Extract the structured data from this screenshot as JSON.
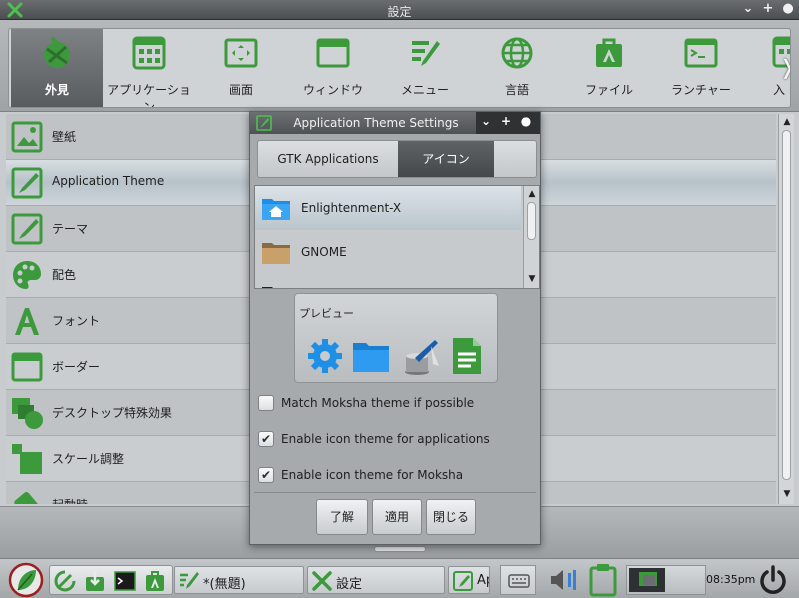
{
  "window": {
    "title": "設定"
  },
  "toolbar": {
    "items": [
      {
        "label": "外見",
        "icon": "appearance-icon",
        "selected": true
      },
      {
        "label": "アプリケーション",
        "icon": "applications-icon"
      },
      {
        "label": "画面",
        "icon": "screen-icon"
      },
      {
        "label": "ウィンドウ",
        "icon": "window-icon"
      },
      {
        "label": "メニュー",
        "icon": "menu-icon"
      },
      {
        "label": "言語",
        "icon": "globe-icon"
      },
      {
        "label": "ファイル",
        "icon": "files-icon"
      },
      {
        "label": "ランチャー",
        "icon": "terminal-icon"
      },
      {
        "label": "入",
        "icon": "input-icon"
      }
    ],
    "arrow_left": "❬",
    "arrow_right": "❭"
  },
  "list": {
    "items": [
      {
        "label": "壁紙",
        "icon": "wallpaper-icon"
      },
      {
        "label": "Application Theme",
        "icon": "brush-icon",
        "selected": true
      },
      {
        "label": "テーマ",
        "icon": "theme-brush-icon"
      },
      {
        "label": "配色",
        "icon": "palette-icon"
      },
      {
        "label": "フォント",
        "icon": "font-icon"
      },
      {
        "label": "ボーダー",
        "icon": "border-icon"
      },
      {
        "label": "デスクトップ特殊効果",
        "icon": "effects-icon"
      },
      {
        "label": "スケール調整",
        "icon": "scale-icon"
      },
      {
        "label": "起動時",
        "icon": "startup-icon"
      }
    ]
  },
  "dialog": {
    "title": "Application Theme Settings",
    "tabs": [
      {
        "label": "GTK Applications",
        "active": false
      },
      {
        "label": "アイコン",
        "active": true
      }
    ],
    "icon_themes": [
      {
        "name": "Enlightenment-X",
        "selected": true
      },
      {
        "name": "GNOME",
        "selected": false
      }
    ],
    "preview": {
      "label": "プレビュー"
    },
    "checks": [
      {
        "label": "Match Moksha theme if possible",
        "checked": false
      },
      {
        "label": "Enable icon theme for applications",
        "checked": true
      },
      {
        "label": "Enable icon theme for Moksha",
        "checked": true
      }
    ],
    "buttons": {
      "ok": "了解",
      "apply": "適用",
      "close": "閉じる"
    }
  },
  "taskbar": {
    "tasks": [
      {
        "label": "*(無題)",
        "icon": "editor-icon"
      },
      {
        "label": "設定",
        "icon": "settings-icon"
      },
      {
        "label": "Ap",
        "icon": "app-theme-icon"
      }
    ],
    "clock": "08:35pm"
  },
  "colors": {
    "accent": "#3c9a3c",
    "folder_blue": "#1e8fe6",
    "selection": "#5b5f62"
  }
}
